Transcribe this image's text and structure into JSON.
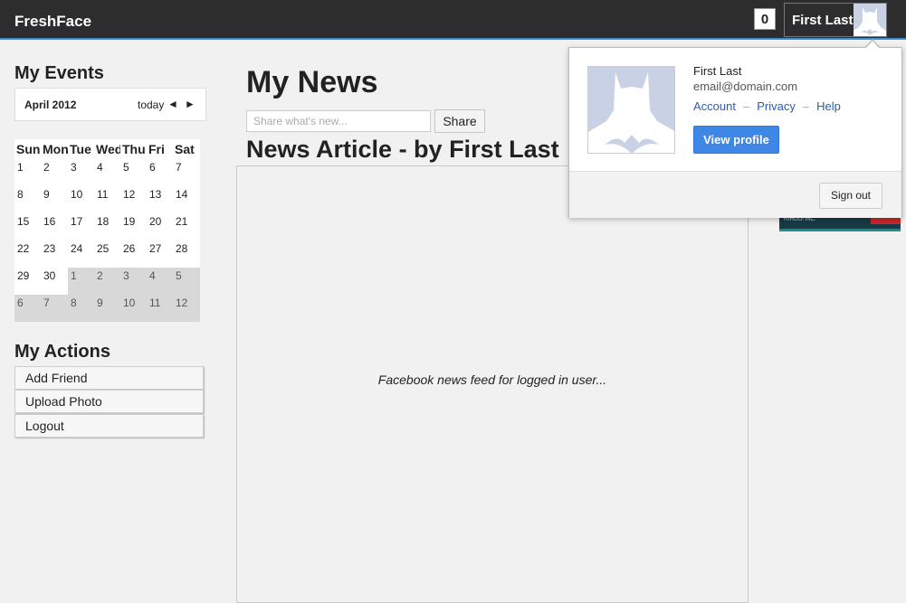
{
  "app": {
    "brand": "FreshFace"
  },
  "header": {
    "notification_count": "0",
    "user_name": "First Last"
  },
  "sidebar": {
    "events_title": "My Events",
    "calendar": {
      "month": "April 2012",
      "today_label": "today",
      "prev_glyph": "◄",
      "next_glyph": "►",
      "weekdays": [
        "Sun",
        "Mon",
        "Tue",
        "Wed",
        "Thu",
        "Fri",
        "Sat"
      ],
      "weeks": [
        [
          {
            "d": "1"
          },
          {
            "d": "2"
          },
          {
            "d": "3"
          },
          {
            "d": "4"
          },
          {
            "d": "5"
          },
          {
            "d": "6"
          },
          {
            "d": "7"
          }
        ],
        [
          {
            "d": "8"
          },
          {
            "d": "9"
          },
          {
            "d": "10"
          },
          {
            "d": "11"
          },
          {
            "d": "12"
          },
          {
            "d": "13"
          },
          {
            "d": "14"
          }
        ],
        [
          {
            "d": "15"
          },
          {
            "d": "16"
          },
          {
            "d": "17"
          },
          {
            "d": "18"
          },
          {
            "d": "19"
          },
          {
            "d": "20"
          },
          {
            "d": "21"
          }
        ],
        [
          {
            "d": "22"
          },
          {
            "d": "23"
          },
          {
            "d": "24"
          },
          {
            "d": "25"
          },
          {
            "d": "26"
          },
          {
            "d": "27"
          },
          {
            "d": "28"
          }
        ],
        [
          {
            "d": "29"
          },
          {
            "d": "30"
          },
          {
            "d": "1",
            "other": true
          },
          {
            "d": "2",
            "other": true
          },
          {
            "d": "3",
            "other": true
          },
          {
            "d": "4",
            "other": true
          },
          {
            "d": "5",
            "other": true
          }
        ],
        [
          {
            "d": "6",
            "other": true
          },
          {
            "d": "7",
            "other": true
          },
          {
            "d": "8",
            "other": true
          },
          {
            "d": "9",
            "other": true
          },
          {
            "d": "10",
            "other": true
          },
          {
            "d": "11",
            "other": true
          },
          {
            "d": "12",
            "other": true
          }
        ]
      ]
    },
    "actions_title": "My Actions",
    "actions": [
      "Add Friend",
      "Upload Photo",
      "Logout"
    ]
  },
  "main": {
    "title": "My News",
    "share_placeholder": "Share what's new...",
    "share_button": "Share",
    "article_title": "News Article - by First Last",
    "feed_text": "Facebook news feed for logged in user..."
  },
  "ticker": {
    "label": "YAHOO! INC."
  },
  "popup": {
    "name": "First Last",
    "email": "email@domain.com",
    "links": [
      "Account",
      "Privacy",
      "Help"
    ],
    "separator": "–",
    "view_profile": "View profile",
    "sign_out": "Sign out"
  },
  "colors": {
    "topbar": "#2d2d2d",
    "accent": "#3b8fd9",
    "button_blue": "#3f87e6",
    "link": "#2a5db0"
  }
}
